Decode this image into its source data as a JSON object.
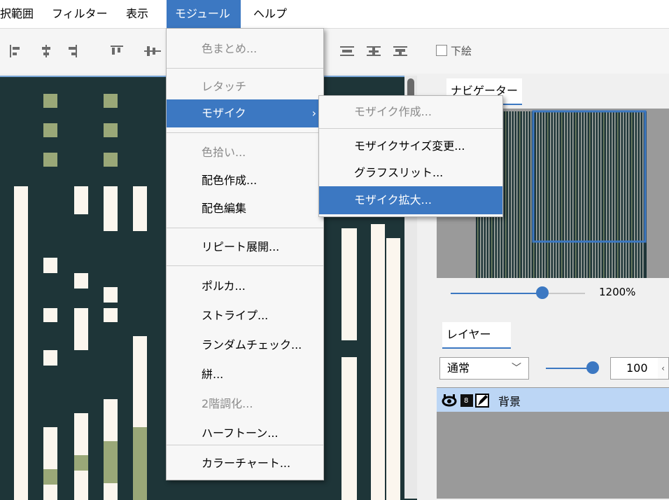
{
  "menubar": {
    "items": [
      "選択範囲",
      "フィルター",
      "表示",
      "モジュール",
      "ヘルプ"
    ],
    "active_index": 3
  },
  "toolbar": {
    "underlay_label": "下絵",
    "underlay_checked": false
  },
  "module_menu": {
    "items": [
      {
        "label": "色まとめ...",
        "disabled": true
      },
      {
        "label": "レタッチ",
        "disabled": true
      },
      {
        "label": "モザイク",
        "disabled": false,
        "submenu": true,
        "highlighted": true
      },
      {
        "label": "色拾い...",
        "disabled": true
      },
      {
        "label": "配色作成...",
        "disabled": false
      },
      {
        "label": "配色編集",
        "disabled": false
      },
      {
        "label": "リピート展開...",
        "disabled": false
      },
      {
        "label": "ポルカ...",
        "disabled": false
      },
      {
        "label": "ストライプ...",
        "disabled": false
      },
      {
        "label": "ランダムチェック...",
        "disabled": false
      },
      {
        "label": "絣...",
        "disabled": false
      },
      {
        "label": "2階調化...",
        "disabled": true
      },
      {
        "label": "ハーフトーン...",
        "disabled": false
      },
      {
        "label": "カラーチャート...",
        "disabled": false
      }
    ]
  },
  "mosaic_submenu": {
    "items": [
      {
        "label": "モザイク作成...",
        "disabled": true
      },
      {
        "label": "モザイクサイズ変更...",
        "disabled": false
      },
      {
        "label": "グラフスリット...",
        "disabled": false
      },
      {
        "label": "モザイク拡大...",
        "disabled": false,
        "highlighted": true
      }
    ]
  },
  "navigator": {
    "tab": "ナビゲーター",
    "zoom": "1200%",
    "zoom_fraction": 0.6
  },
  "layers": {
    "tab": "レイヤー",
    "blend_mode": "通常",
    "opacity": "100",
    "opacity_fraction": 1.0,
    "rows": [
      {
        "name": "背景",
        "visible": true
      }
    ]
  },
  "colors": {
    "accent": "#3c78c2",
    "canvas_dark": "#1e3538",
    "pattern_cream": "#fbf6ee",
    "pattern_green": "#9aa878"
  }
}
